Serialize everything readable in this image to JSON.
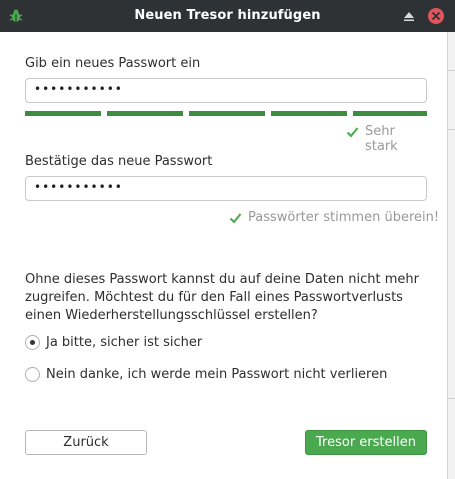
{
  "window": {
    "title": "Neuen Tresor hinzufügen",
    "app_icon": "bug-icon",
    "controls": [
      "maximize-icon",
      "close-icon"
    ]
  },
  "password": {
    "label": "Gib ein neues Passwort ein",
    "value": "•••••••••••",
    "strength_segments_filled": 5,
    "strength_segments_total": 5,
    "strength_text": "Sehr stark",
    "strength_color": "#3d8c3f"
  },
  "confirm": {
    "label": "Bestätige das neue Passwort",
    "value": "•••••••••••",
    "match_text": "Passwörter stimmen überein!"
  },
  "recovery": {
    "description": "Ohne dieses Passwort kannst du auf deine Daten nicht mehr zugreifen. Möchtest du für den Fall eines Passwortverlusts einen Wiederherstellungsschlüssel erstellen?",
    "option_yes": "Ja bitte, sicher ist sicher",
    "option_no": "Nein danke, ich werde mein Passwort nicht verlieren",
    "selected": "yes"
  },
  "buttons": {
    "back": "Zurück",
    "create": "Tresor erstellen"
  },
  "colors": {
    "titlebar": "#2f3234",
    "accent_green": "#4aa84f",
    "close_red": "#e1555d"
  }
}
